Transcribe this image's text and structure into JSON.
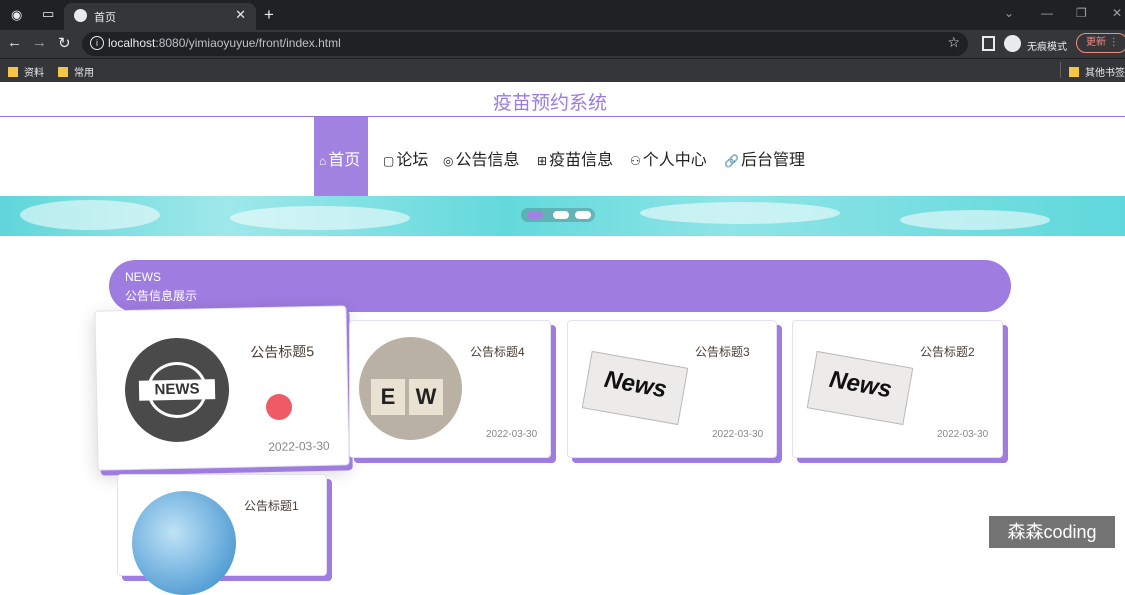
{
  "browser": {
    "tab_title": "首页",
    "url_host": "localhost",
    "url_rest": ":8080/yimiaoyuyue/front/index.html",
    "incognito_label": "无痕模式",
    "update_label": "更新",
    "bookmarks": [
      "资料",
      "常用"
    ],
    "other_bookmarks": "其他书签"
  },
  "site": {
    "title": "疫苗预约系统",
    "menu": [
      {
        "icon": "⌂",
        "label": "首页",
        "active": true
      },
      {
        "icon": "▢",
        "label": "论坛"
      },
      {
        "icon": "◎",
        "label": "公告信息"
      },
      {
        "icon": "⊞",
        "label": "疫苗信息"
      },
      {
        "icon": "⚇",
        "label": "个人中心"
      },
      {
        "icon": "🔗",
        "label": "后台管理"
      }
    ]
  },
  "news_section": {
    "en": "NEWS",
    "cn": "公告信息展示"
  },
  "news_cards": [
    {
      "title": "公告标题5",
      "date": "2022-03-30"
    },
    {
      "title": "公告标题4",
      "date": "2022-03-30"
    },
    {
      "title": "公告标题3",
      "date": "2022-03-30"
    },
    {
      "title": "公告标题2",
      "date": "2022-03-30"
    },
    {
      "title": "公告标题1",
      "date": ""
    }
  ],
  "watermark": "森森coding",
  "colors": {
    "accent": "#a282e0",
    "banner": "#63d9dc",
    "cursor": "#ef5b64"
  }
}
